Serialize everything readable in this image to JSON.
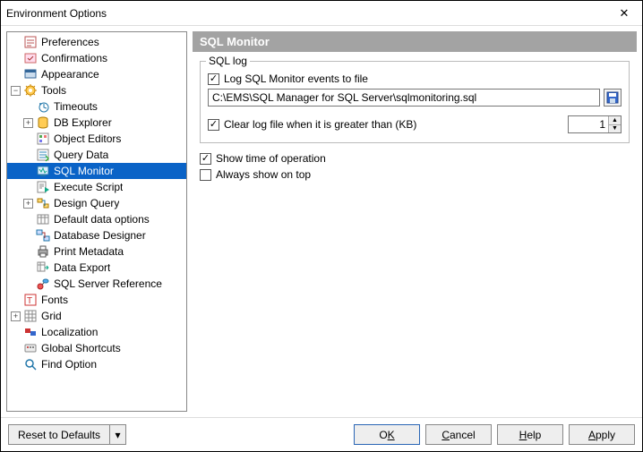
{
  "window": {
    "title": "Environment Options"
  },
  "tree": {
    "preferences": "Preferences",
    "confirmations": "Confirmations",
    "appearance": "Appearance",
    "tools": "Tools",
    "timeouts": "Timeouts",
    "db_explorer": "DB Explorer",
    "object_editors": "Object Editors",
    "query_data": "Query Data",
    "sql_monitor": "SQL Monitor",
    "execute_script": "Execute Script",
    "design_query": "Design Query",
    "default_data_options": "Default data options",
    "database_designer": "Database Designer",
    "print_metadata": "Print Metadata",
    "data_export": "Data Export",
    "sql_server_reference": "SQL Server Reference",
    "fonts": "Fonts",
    "grid": "Grid",
    "localization": "Localization",
    "global_shortcuts": "Global Shortcuts",
    "find_option": "Find Option"
  },
  "panel": {
    "header": "SQL Monitor",
    "sql_log_legend": "SQL log",
    "log_events": "Log SQL Monitor events to file",
    "path": "C:\\EMS\\SQL Manager for SQL Server\\sqlmonitoring.sql",
    "clear_log": "Clear log file when it is greater than (KB)",
    "kb_value": "1",
    "show_time": "Show time of operation",
    "always_top": "Always show on top"
  },
  "footer": {
    "reset": "Reset to Defaults",
    "ok_pre": "O",
    "ok_u": "K",
    "cancel_u": "C",
    "cancel_post": "ancel",
    "help_u": "H",
    "help_post": "elp",
    "apply_u": "A",
    "apply_post": "pply"
  }
}
